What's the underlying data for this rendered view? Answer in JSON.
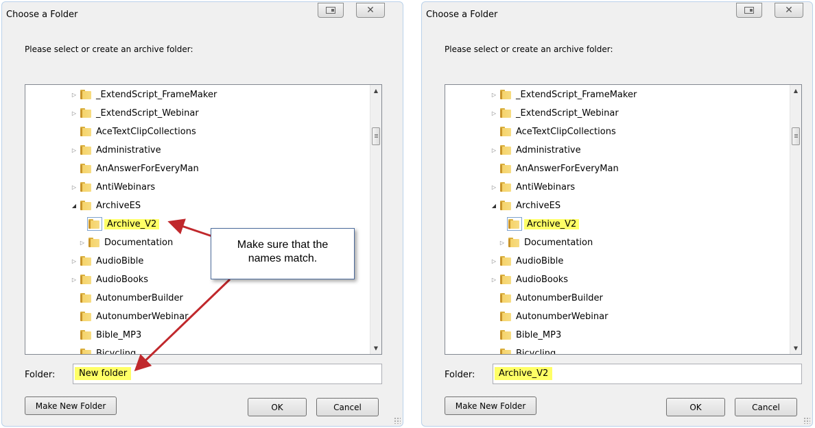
{
  "dialogs": [
    {
      "title": "Choose a Folder",
      "instruction": "Please select or create an archive folder:",
      "tree": [
        {
          "label": "_ExtendScript_FrameMaker",
          "level": 0,
          "expander": "closed"
        },
        {
          "label": "_ExtendScript_Webinar",
          "level": 0,
          "expander": "closed"
        },
        {
          "label": "AceTextClipCollections",
          "level": 0,
          "expander": "none"
        },
        {
          "label": "Administrative",
          "level": 0,
          "expander": "closed"
        },
        {
          "label": "AnAnswerForEveryMan",
          "level": 0,
          "expander": "none"
        },
        {
          "label": "AntiWebinars",
          "level": 0,
          "expander": "closed"
        },
        {
          "label": "ArchiveES",
          "level": 0,
          "expander": "open"
        },
        {
          "label": "Archive_V2",
          "level": 1,
          "expander": "none",
          "selected": true,
          "highlight": true
        },
        {
          "label": "Documentation",
          "level": 1,
          "expander": "closed"
        },
        {
          "label": "AudioBible",
          "level": 0,
          "expander": "closed"
        },
        {
          "label": "AudioBooks",
          "level": 0,
          "expander": "closed"
        },
        {
          "label": "AutonumberBuilder",
          "level": 0,
          "expander": "none"
        },
        {
          "label": "AutonumberWebinar",
          "level": 0,
          "expander": "none"
        },
        {
          "label": "Bible_MP3",
          "level": 0,
          "expander": "none"
        },
        {
          "label": "Bicycling",
          "level": 0,
          "expander": "none"
        }
      ],
      "folder_label": "Folder:",
      "folder_value": "New folder",
      "make_new_folder": "Make New Folder",
      "ok": "OK",
      "cancel": "Cancel"
    },
    {
      "title": "Choose a Folder",
      "instruction": "Please select or create an archive folder:",
      "tree": [
        {
          "label": "_ExtendScript_FrameMaker",
          "level": 0,
          "expander": "closed"
        },
        {
          "label": "_ExtendScript_Webinar",
          "level": 0,
          "expander": "closed"
        },
        {
          "label": "AceTextClipCollections",
          "level": 0,
          "expander": "none"
        },
        {
          "label": "Administrative",
          "level": 0,
          "expander": "closed"
        },
        {
          "label": "AnAnswerForEveryMan",
          "level": 0,
          "expander": "none"
        },
        {
          "label": "AntiWebinars",
          "level": 0,
          "expander": "closed"
        },
        {
          "label": "ArchiveES",
          "level": 0,
          "expander": "open"
        },
        {
          "label": "Archive_V2",
          "level": 1,
          "expander": "none",
          "selected": true,
          "highlight": true
        },
        {
          "label": "Documentation",
          "level": 1,
          "expander": "closed"
        },
        {
          "label": "AudioBible",
          "level": 0,
          "expander": "closed"
        },
        {
          "label": "AudioBooks",
          "level": 0,
          "expander": "closed"
        },
        {
          "label": "AutonumberBuilder",
          "level": 0,
          "expander": "none"
        },
        {
          "label": "AutonumberWebinar",
          "level": 0,
          "expander": "none"
        },
        {
          "label": "Bible_MP3",
          "level": 0,
          "expander": "none"
        },
        {
          "label": "Bicycling",
          "level": 0,
          "expander": "none"
        }
      ],
      "folder_label": "Folder:",
      "folder_value": "Archive_V2",
      "make_new_folder": "Make New Folder",
      "ok": "OK",
      "cancel": "Cancel"
    }
  ],
  "callout": {
    "line1": "Make sure that the",
    "line2": "names match."
  },
  "colors": {
    "highlight": "#ffff66",
    "arrow": "#c0282c",
    "folder": "#f5d36a"
  }
}
